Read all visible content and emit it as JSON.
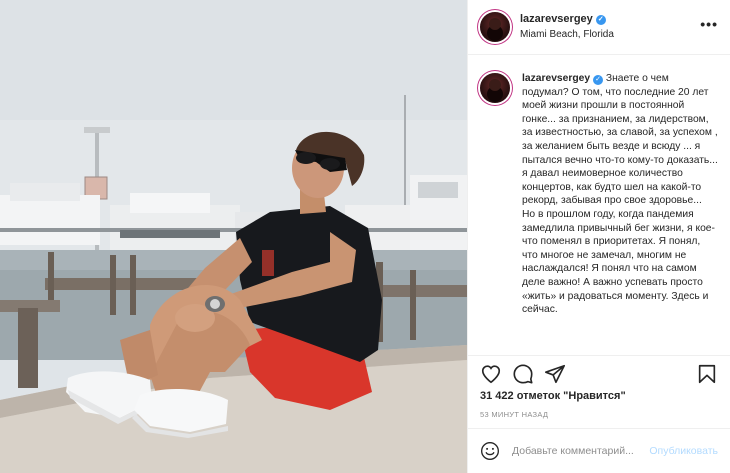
{
  "post": {
    "username": "lazarevsergey",
    "location": "Miami Beach, Florida",
    "more_label": "•••",
    "caption_username": "lazarevsergey",
    "caption_text": " Знаете о чем подумал? О том, что последние 20 лет моей жизни прошли в постоянной гонке... за признанием, за лидерством, за известностью, за славой, за успехом , за желанием быть везде и всюду ... я пытался вечно что-то кому-то доказать... я давал неимоверное количество концертов, как будто шел на какой-то рекорд, забывая про свое здоровье...\nНо в прошлом году, когда пандемия замедлила привычный бег жизни, я кое-что поменял в приоритетах. Я понял, что многое не замечал, многим не наслаждался! Я понял что на самом деле важно! А важно успевать просто «жить» и радоваться моменту. Здесь и сейчас.",
    "likes": "31 422 отметок \"Нравится\"",
    "time": "53 МИНУТ НАЗАД",
    "comment_placeholder": "Добавьте комментарий...",
    "publish_label": "Опубликовать"
  },
  "icons": {
    "heart": "heart-icon",
    "comment": "comment-icon",
    "share": "share-icon",
    "save": "bookmark-icon",
    "emoji": "emoji-icon",
    "verified": "verified-icon",
    "more": "more-icon"
  },
  "colors": {
    "verified": "#3897f0",
    "publish_disabled": "#b3dbff",
    "muted": "#8e8e8e",
    "text": "#262626"
  }
}
